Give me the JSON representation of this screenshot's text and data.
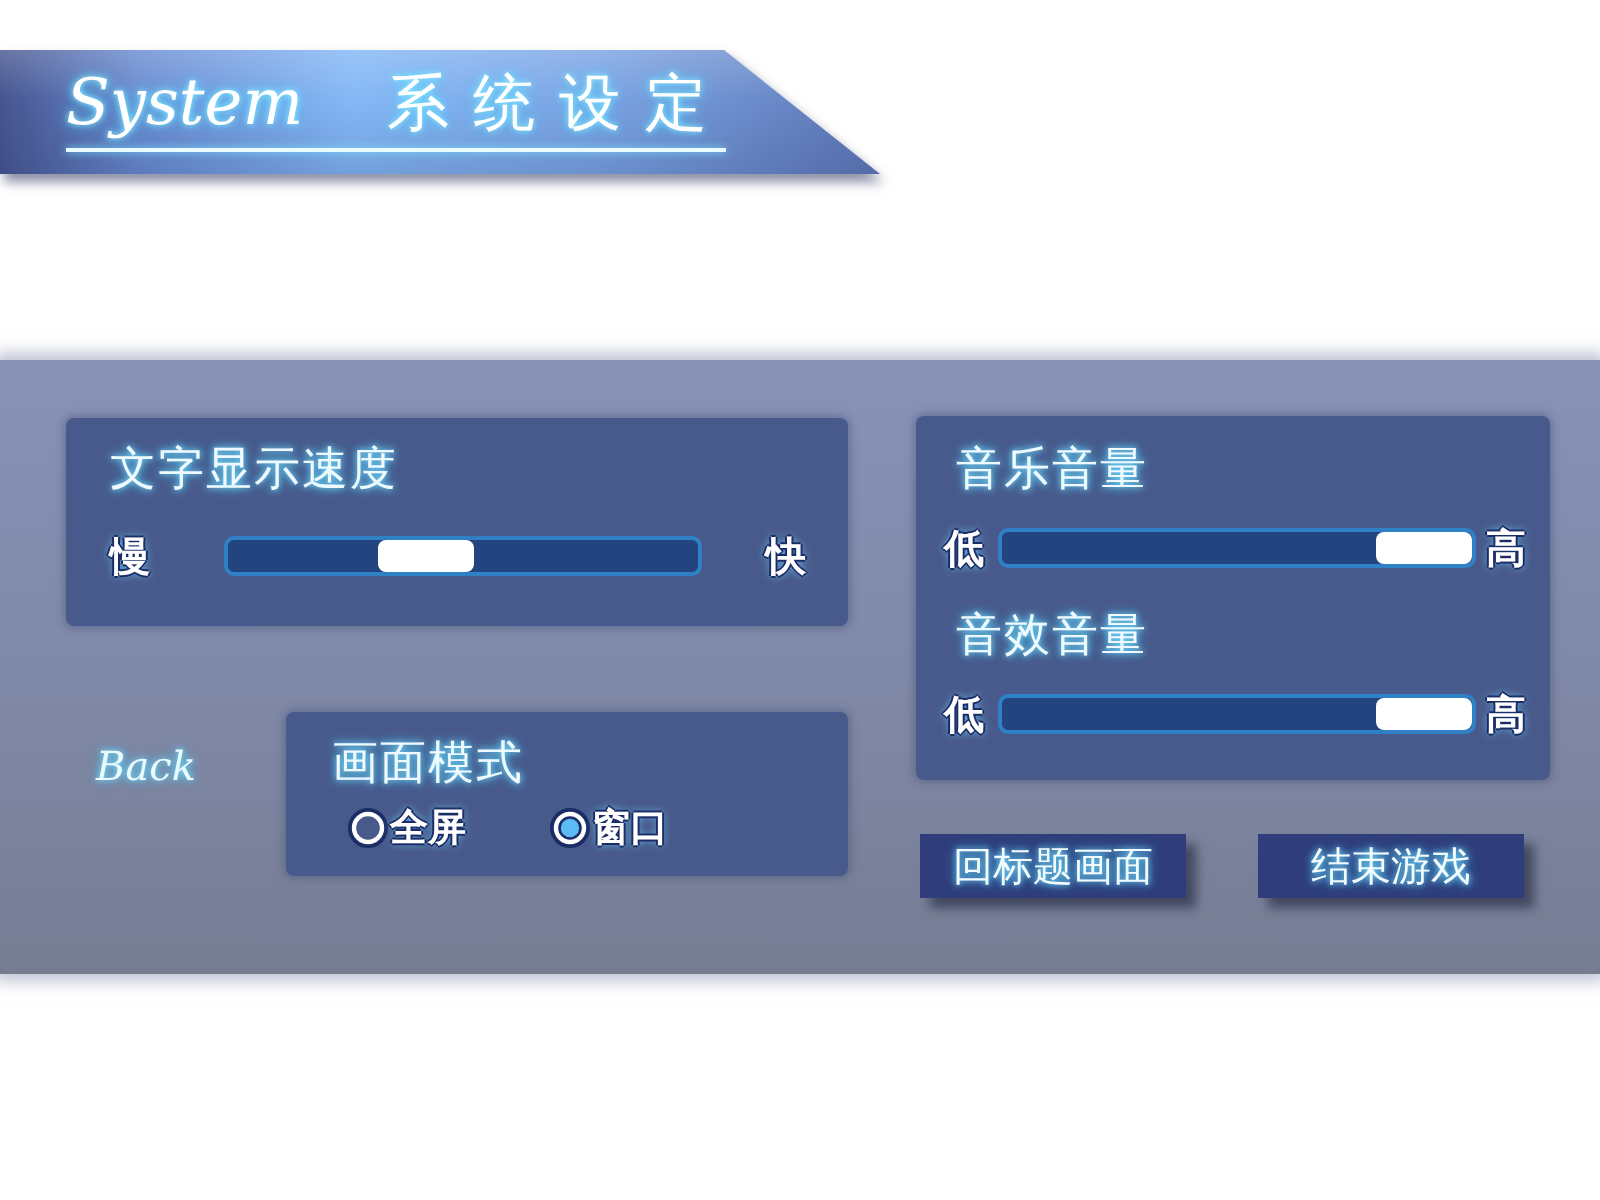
{
  "banner": {
    "title": "System",
    "subtitle": "系统设定"
  },
  "text_speed": {
    "title": "文字显示速度",
    "slider": {
      "min_label": "慢",
      "max_label": "快",
      "level": 0.4
    }
  },
  "volume": {
    "sliders": [
      {
        "title": "音乐音量",
        "min_label": "低",
        "max_label": "高",
        "level": 1
      },
      {
        "title": "音效音量",
        "min_label": "低",
        "max_label": "高",
        "level": 1
      }
    ]
  },
  "back": {
    "label": "Back"
  },
  "display_mode": {
    "title": "画面模式",
    "options": [
      {
        "label": "全屏",
        "selected": false
      },
      {
        "label": "窗口",
        "selected": true
      }
    ]
  },
  "buttons": [
    "回标题画面",
    "结束游戏"
  ]
}
